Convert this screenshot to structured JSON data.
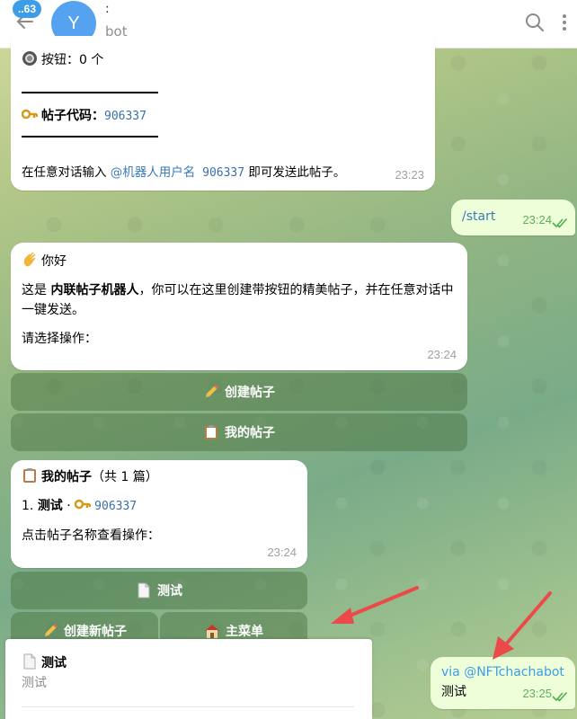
{
  "header": {
    "unread_count": "..63",
    "avatar_letter": "Y",
    "chat_name": ":",
    "chat_subtitle": "bot"
  },
  "msg1": {
    "buttons_line": "按钮：0 个",
    "rule_top": "————————————",
    "code_label": "帖子代码：",
    "code_value": "906337",
    "rule_bottom": "————————————",
    "hint_prefix": "在任意对话输入 ",
    "hint_link": "@机器人用户名",
    "hint_code": " 906337",
    "hint_suffix": " 即可发送此帖子。",
    "time": "23:23"
  },
  "msg_start": {
    "text": "/start",
    "time": "23:24"
  },
  "msg2": {
    "greeting": "你好",
    "line1_prefix": "这是 ",
    "line1_bold": "内联帖子机器人",
    "line1_suffix": "，你可以在这里创建带按钮的精美帖子，并在任意对话中一键发送。",
    "prompt": "请选择操作：",
    "time": "23:24",
    "btn_create": "创建帖子",
    "btn_my": "我的帖子"
  },
  "msg3": {
    "title_bold": "我的帖子",
    "title_suffix": "（共 1 篇）",
    "item_index": "1. ",
    "item_name": "测试",
    "item_sep": " · ",
    "item_code": "906337",
    "hint": "点击帖子名称查看操作：",
    "time": "23:24",
    "btn_test": "测试",
    "btn_new": "创建新帖子",
    "btn_menu": "主菜单"
  },
  "inline_result": {
    "title": "测试",
    "subtitle": "测试"
  },
  "msg_via": {
    "via": "via @NFTchachabot",
    "text": "测试",
    "time": "23:25"
  },
  "colors": {
    "accent": "#3e9de7",
    "outgoing": "#eefed8",
    "arrow": "#ec4a4a"
  },
  "icons": [
    "back-arrow-icon",
    "search-icon",
    "more-vertical-icon",
    "radio-icon",
    "key-icon",
    "wave-icon",
    "clipboard-icon",
    "pencil-icon",
    "document-icon",
    "house-icon",
    "double-check-icon"
  ]
}
